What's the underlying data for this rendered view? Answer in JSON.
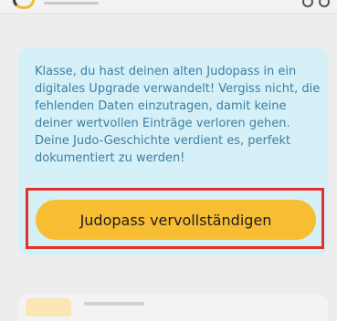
{
  "banner": {
    "message": "Klasse, du hast deinen alten Judopass in ein digitales Upgrade verwandelt! Vergiss nicht, die fehlenden Daten einzutragen, damit keine deiner wertvollen Einträge verloren gehen. Deine Judo-Geschichte verdient es, perfekt dokumentiert zu werden!",
    "button_label": "Judopass vervollständigen"
  },
  "colors": {
    "banner_bg": "#d6f0f7",
    "banner_text": "#3c7fa4",
    "button_bg": "#f7bd33",
    "highlight": "#e0332b"
  }
}
